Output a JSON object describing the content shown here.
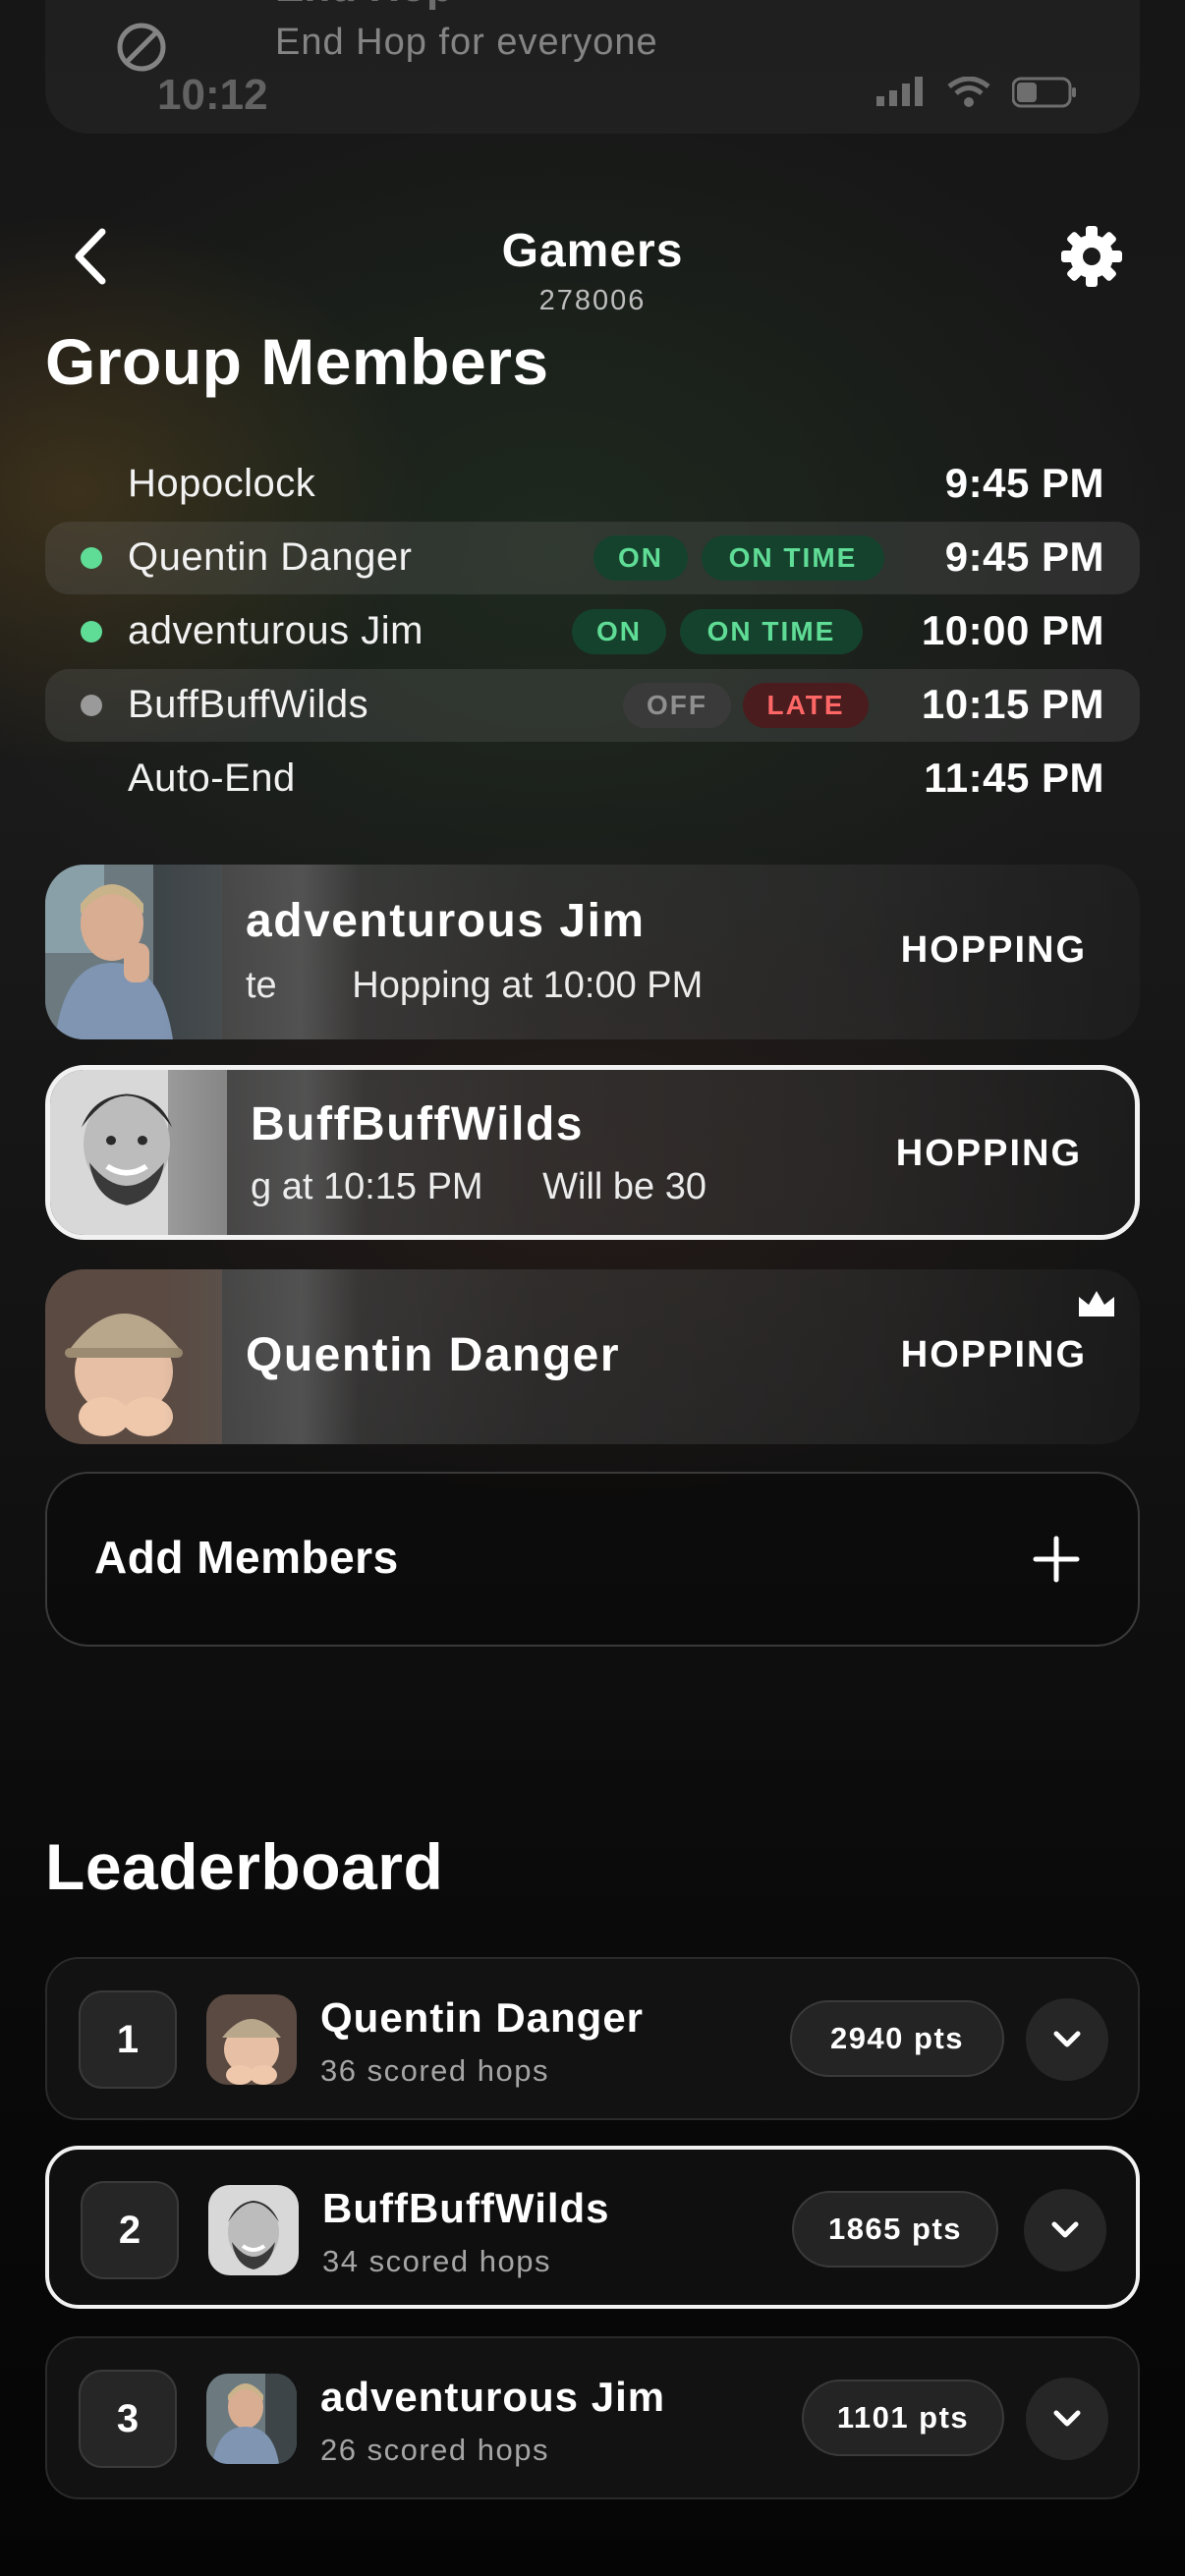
{
  "status_bar": {
    "time": "10:12"
  },
  "notification": {
    "title": "End Hop",
    "body": "End Hop for everyone"
  },
  "header": {
    "group_name": "Gamers",
    "group_code": "278006"
  },
  "members_section": {
    "title": "Group Members"
  },
  "schedule": [
    {
      "name": "Hopoclock",
      "time": "9:45 PM",
      "dot": "",
      "highlight": false,
      "online": "",
      "punctuality": ""
    },
    {
      "name": "Quentin Danger",
      "time": "9:45 PM",
      "dot": "#5fdc95",
      "highlight": true,
      "online": "ON",
      "punctuality": "ON TIME"
    },
    {
      "name": "adventurous Jim",
      "time": "10:00 PM",
      "dot": "#5fdc95",
      "highlight": false,
      "online": "ON",
      "punctuality": "ON TIME"
    },
    {
      "name": "BuffBuffWilds",
      "time": "10:15 PM",
      "dot": "#9a9a9a",
      "highlight": true,
      "online": "OFF",
      "punctuality": "LATE"
    },
    {
      "name": "Auto-End",
      "time": "11:45 PM",
      "dot": "",
      "highlight": false,
      "online": "",
      "punctuality": ""
    }
  ],
  "member_cards": [
    {
      "name": "adventurous Jim",
      "ticker_start": "te",
      "ticker": "Hopping at 10:00 PM",
      "status": "HOPPING",
      "selected": false,
      "host": false
    },
    {
      "name": "BuffBuffWilds",
      "ticker_start": "g at 10:15 PM",
      "ticker": "Will be 30",
      "status": "HOPPING",
      "selected": true,
      "host": false
    },
    {
      "name": "Quentin Danger",
      "ticker_start": "",
      "ticker": "",
      "status": "HOPPING",
      "selected": false,
      "host": true
    }
  ],
  "add_members": {
    "label": "Add Members"
  },
  "leaderboard": {
    "title": "Leaderboard",
    "entries": [
      {
        "rank": "1",
        "name": "Quentin Danger",
        "hops": "36 scored hops",
        "points": "2940 pts",
        "selected": false
      },
      {
        "rank": "2",
        "name": "BuffBuffWilds",
        "hops": "34 scored hops",
        "points": "1865 pts",
        "selected": true
      },
      {
        "rank": "3",
        "name": "adventurous Jim",
        "hops": "26 scored hops",
        "points": "1101 pts",
        "selected": false
      }
    ]
  },
  "colors": {
    "on": "#5fdc95",
    "late": "#ff6666",
    "off": "#8f8f8f"
  },
  "icons": [
    "no-entry-icon",
    "back-chevron-icon",
    "gear-icon",
    "crown-icon",
    "plus-icon",
    "chevron-down-icon"
  ]
}
